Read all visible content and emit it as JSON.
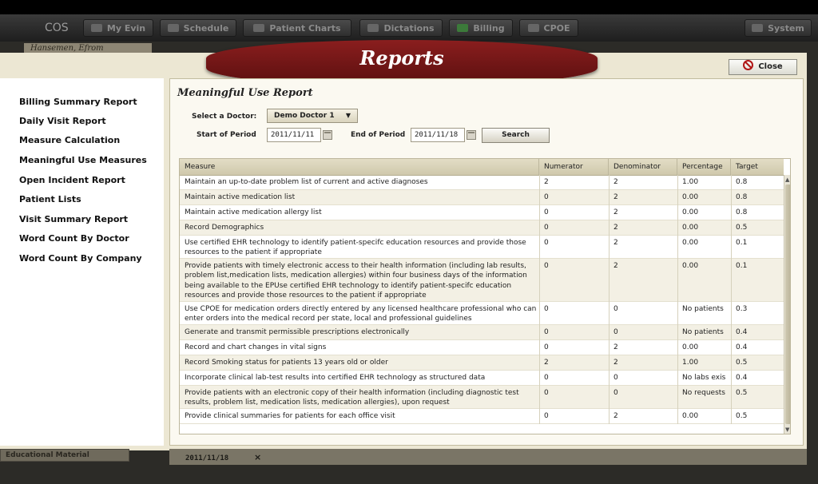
{
  "app": {
    "brand": "COS"
  },
  "nav": [
    {
      "label": "My Evin"
    },
    {
      "label": "Schedule"
    },
    {
      "label": "Patient Charts"
    },
    {
      "label": "Dictations"
    },
    {
      "label": "Billing"
    },
    {
      "label": "CPOE"
    },
    {
      "label": "System"
    }
  ],
  "under_label": "Hansemen, Efrom",
  "banner": {
    "title": "Reports"
  },
  "close": {
    "label": "Close"
  },
  "sidebar": {
    "items": [
      {
        "label": "Billing Summary Report"
      },
      {
        "label": "Daily Visit Report"
      },
      {
        "label": "Measure Calculation"
      },
      {
        "label": "Meaningful Use Measures"
      },
      {
        "label": "Open Incident Report"
      },
      {
        "label": "Patient Lists"
      },
      {
        "label": "Visit Summary Report"
      },
      {
        "label": "Word Count By Doctor"
      },
      {
        "label": "Word Count By Company"
      }
    ]
  },
  "report": {
    "title": "Meaningful Use Report",
    "doctor_label": "Select a Doctor:",
    "doctor_value": "Demo Doctor 1",
    "start_label": "Start of Period",
    "start_value": "2011/11/11",
    "end_label": "End of Period",
    "end_value": "2011/11/18",
    "search_label": "Search"
  },
  "table": {
    "headers": [
      "Measure",
      "Numerator",
      "Denominator",
      "Percentage",
      "Target"
    ],
    "rows": [
      {
        "measure": "Maintain an up-to-date problem list of current and active diagnoses",
        "num": "2",
        "den": "2",
        "pct": "1.00",
        "tgt": "0.8"
      },
      {
        "measure": "Maintain active medication list",
        "num": "0",
        "den": "2",
        "pct": "0.00",
        "tgt": "0.8"
      },
      {
        "measure": "Maintain active medication allergy list",
        "num": "0",
        "den": "2",
        "pct": "0.00",
        "tgt": "0.8"
      },
      {
        "measure": "Record Demographics",
        "num": "0",
        "den": "2",
        "pct": "0.00",
        "tgt": "0.5"
      },
      {
        "measure": "Use certified EHR technology to identify patient-specifc education resources and provide those resources to the patient if appropriate",
        "num": "0",
        "den": "2",
        "pct": "0.00",
        "tgt": "0.1"
      },
      {
        "measure": "Provide patients with timely electronic access to their health information (including lab results, problem list,medication lists, medication allergies) within four business days of the information being available to the EPUse certified EHR technology to identify patient-specifc education resources and provide those resources to the patient if appropriate",
        "num": "0",
        "den": "2",
        "pct": "0.00",
        "tgt": "0.1"
      },
      {
        "measure": "Use CPOE for medication orders directly entered by any licensed healthcare professional who can enter orders into the medical record per state, local and professional guidelines",
        "num": "0",
        "den": "0",
        "pct": "No patients",
        "tgt": "0.3"
      },
      {
        "measure": "Generate and transmit permissible prescriptions electronically",
        "num": "0",
        "den": "0",
        "pct": "No patients",
        "tgt": "0.4"
      },
      {
        "measure": "Record and chart changes in vital signs",
        "num": "0",
        "den": "2",
        "pct": "0.00",
        "tgt": "0.4"
      },
      {
        "measure": "Record Smoking status for patients 13 years old or older",
        "num": "2",
        "den": "2",
        "pct": "1.00",
        "tgt": "0.5"
      },
      {
        "measure": "Incorporate clinical lab-test results into certified EHR technology as structured data",
        "num": "0",
        "den": "0",
        "pct": "No labs exis",
        "tgt": "0.4"
      },
      {
        "measure": "Provide patients with an electronic copy of their health information (including diagnostic test results, problem list, medication lists, medication allergies), upon request",
        "num": "0",
        "den": "0",
        "pct": "No requests",
        "tgt": "0.5"
      },
      {
        "measure": "Provide clinical summaries for patients for each office visit",
        "num": "0",
        "den": "2",
        "pct": "0.00",
        "tgt": "0.5"
      }
    ]
  },
  "bottom": {
    "left_label": "Educational Material",
    "date": "2011/11/18",
    "close_x": "×"
  }
}
